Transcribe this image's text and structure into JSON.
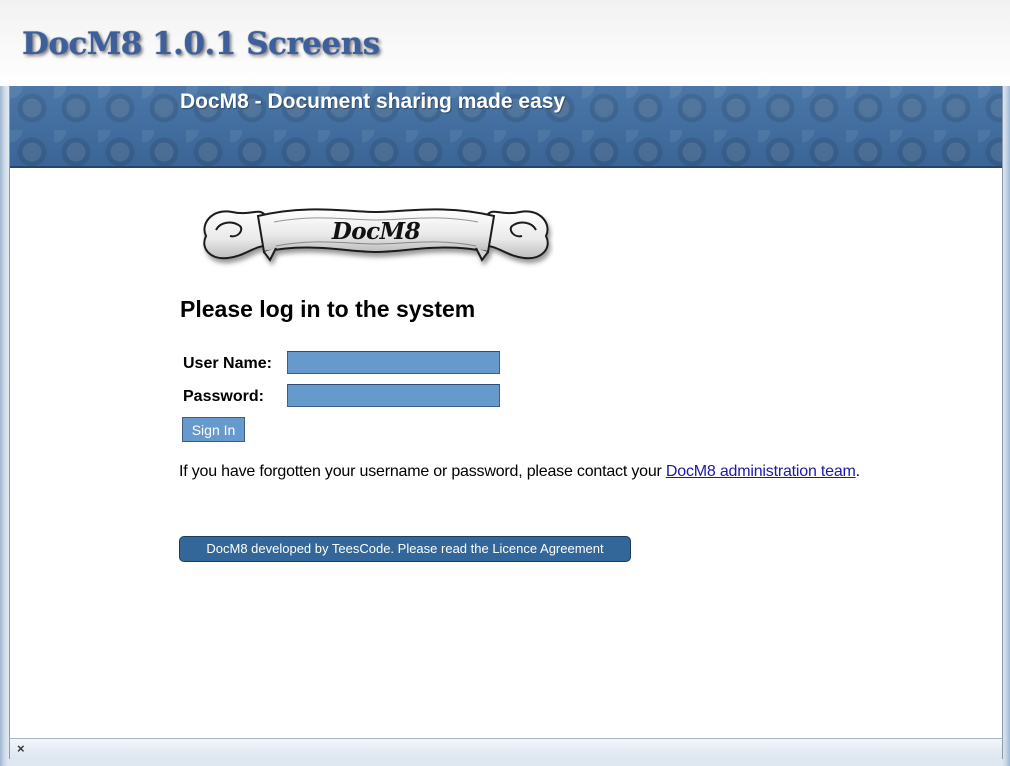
{
  "caption": {
    "title": "DocM8 1.0.1 Screens"
  },
  "header": {
    "site_title": "DocM8 - Document sharing made easy"
  },
  "logo": {
    "text": "DocM8"
  },
  "login": {
    "heading": "Please log in to the system",
    "username_label": "User Name:",
    "username_value": "",
    "password_label": "Password:",
    "password_value": "",
    "signin_label": "Sign In",
    "help_prefix": "If you have forgotten your username or password, please contact your ",
    "help_link": "DocM8 administration team",
    "help_suffix": "."
  },
  "footer": {
    "text": "DocM8 developed by TeesCode. Please read the Licence Agreement"
  },
  "status_bar": {
    "close_glyph": "×"
  },
  "colors": {
    "header_blue": "#3e6a9c",
    "input_blue": "#6699cc",
    "footer_blue": "#336699",
    "link_blue": "#1a1aa6",
    "caption_blue": "#3d5f9c"
  },
  "icons": [
    "close-icon"
  ]
}
